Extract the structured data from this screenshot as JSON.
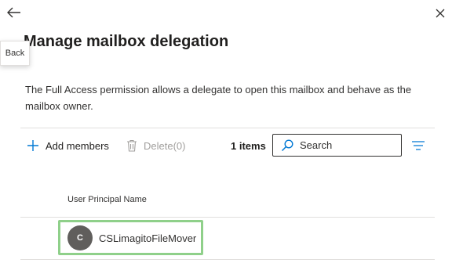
{
  "panel": {
    "back_tooltip": "Back",
    "title": "Manage mailbox delegation",
    "description": "The Full Access permission allows a delegate to open this mailbox and behave as the mailbox owner."
  },
  "toolbar": {
    "add_members_label": "Add members",
    "delete_label": "Delete(0)",
    "items_count": "1 items",
    "search_placeholder": "Search"
  },
  "table": {
    "columns": [
      "User Principal Name"
    ],
    "rows": [
      {
        "avatar_initial": "C",
        "user_principal_name": "CSLimagitoFileMover"
      }
    ]
  },
  "icons": {
    "back": "arrow-left-icon",
    "close": "close-icon",
    "add": "plus-icon",
    "delete": "trash-icon",
    "search": "search-icon",
    "filter": "filter-lines-icon"
  },
  "colors": {
    "accent": "#0078d4",
    "highlight": "#8fd08a",
    "avatar": "#605e5c"
  }
}
